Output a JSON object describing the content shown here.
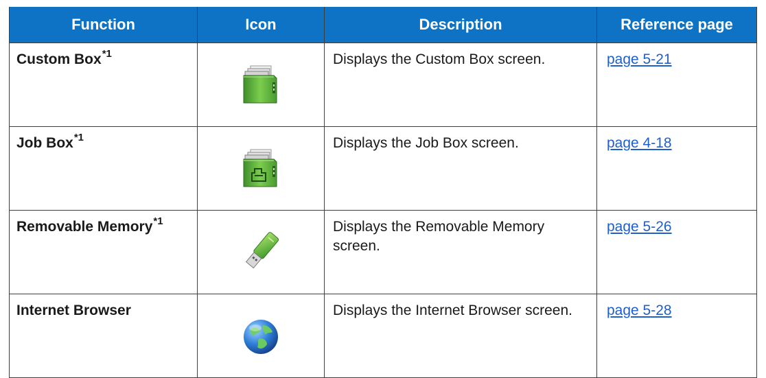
{
  "table": {
    "headers": {
      "function": "Function",
      "icon": "Icon",
      "description": "Description",
      "reference": "Reference page"
    },
    "rows": [
      {
        "function": "Custom Box",
        "note": "*1",
        "icon": "custom-box-icon",
        "description": "Displays the Custom Box screen.",
        "reference": "page 5-21"
      },
      {
        "function": "Job Box",
        "note": "*1",
        "icon": "job-box-icon",
        "description": "Displays the Job Box screen.",
        "reference": "page 4-18"
      },
      {
        "function": "Removable Memory",
        "note": "*1",
        "icon": "usb-memory-icon",
        "description": "Displays the Removable Memory screen.",
        "reference": "page 5-26"
      },
      {
        "function": "Internet Browser",
        "note": "",
        "icon": "globe-icon",
        "description": "Displays the Internet Browser screen.",
        "reference": "page 5-28"
      }
    ]
  },
  "colors": {
    "header_background": "#0e73c4",
    "header_text": "#ffffff",
    "link": "#1f5fcb",
    "border": "#3d3d3d"
  }
}
